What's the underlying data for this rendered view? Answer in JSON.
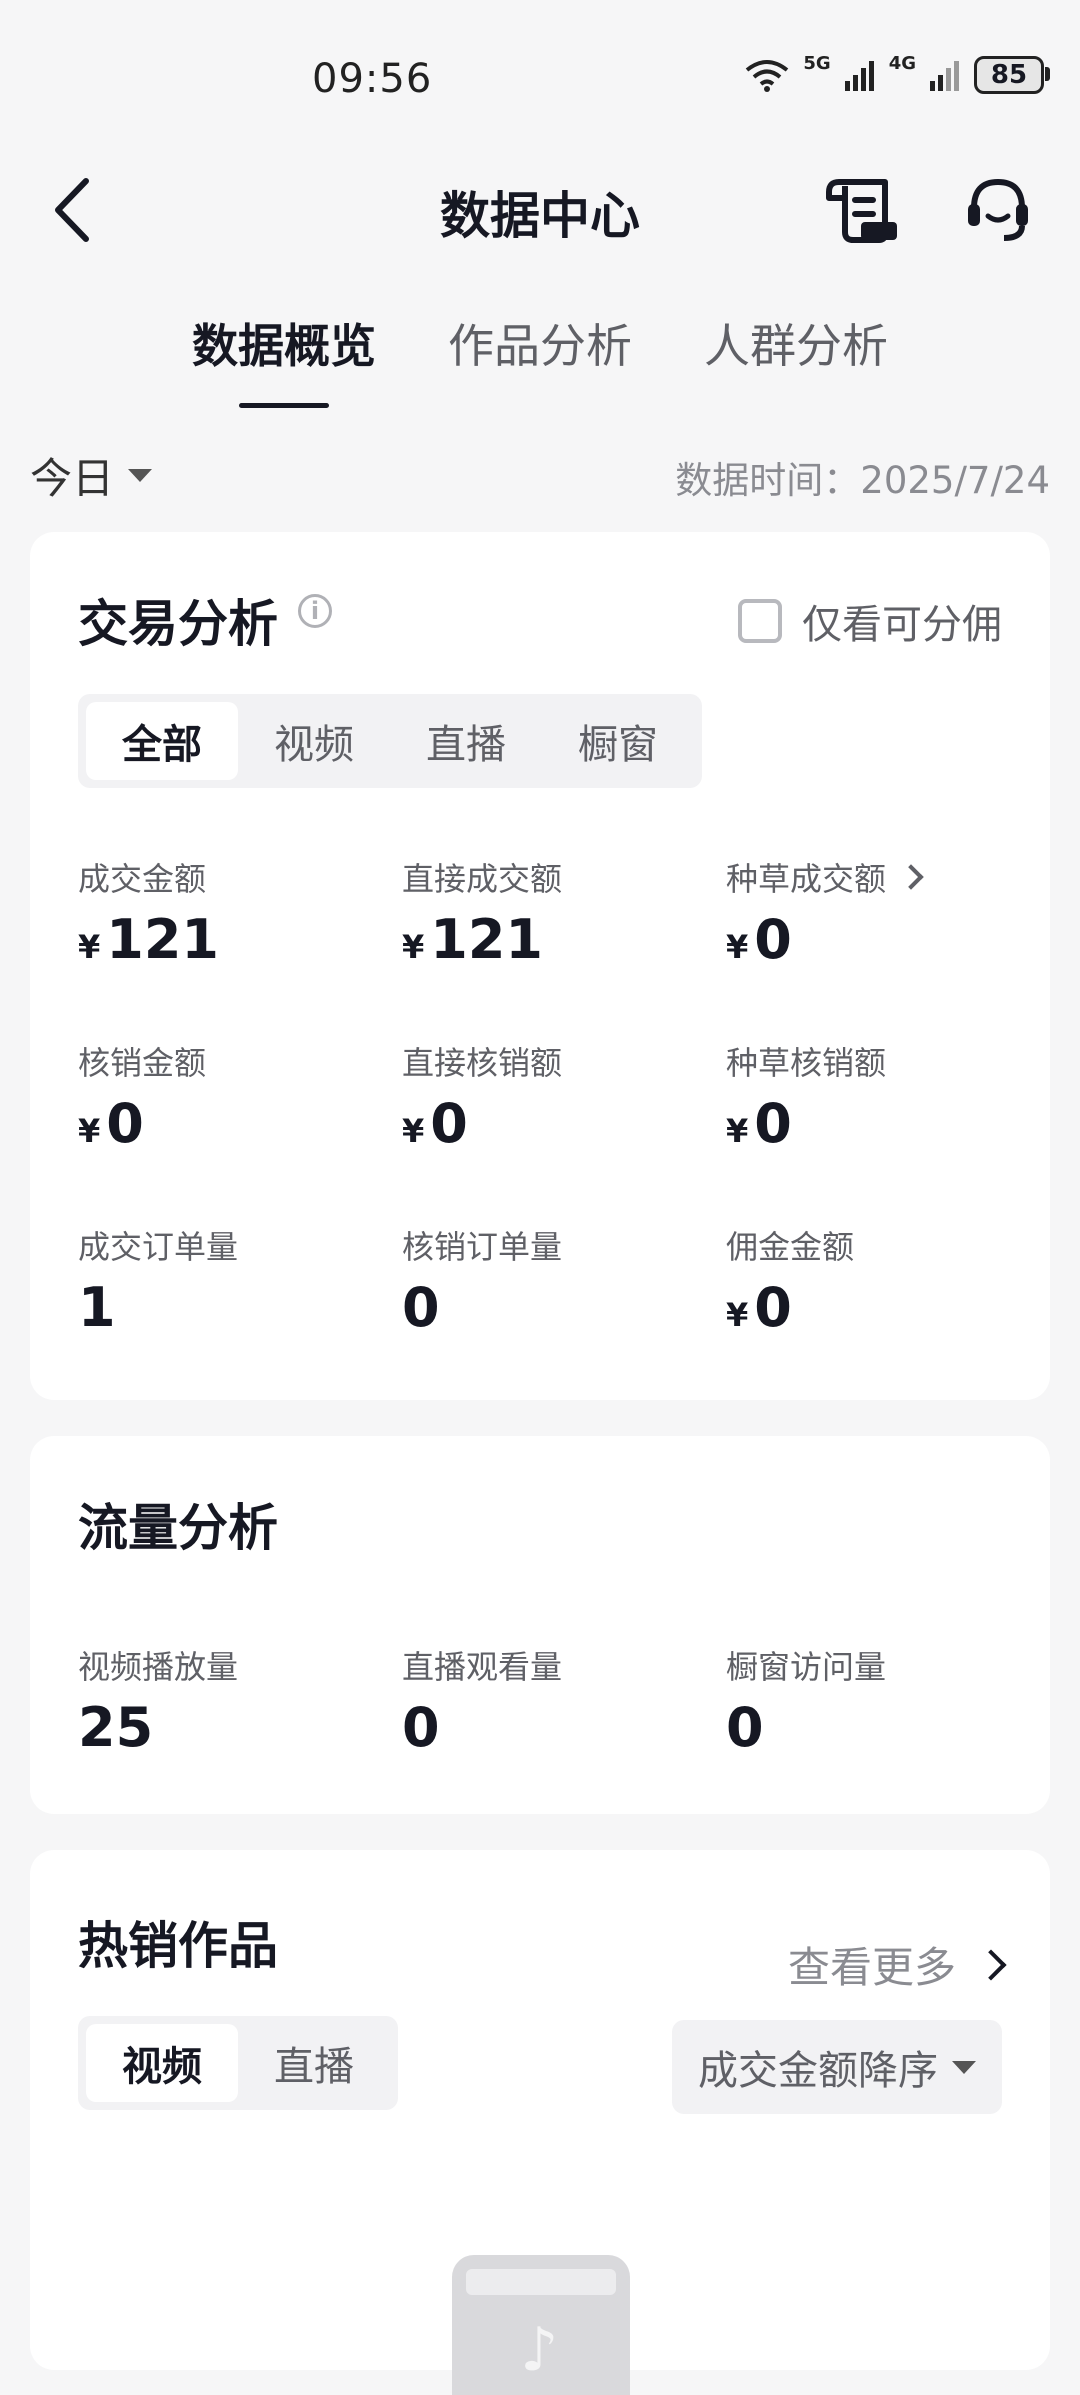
{
  "status_bar": {
    "time": "09:56",
    "battery": "85",
    "signal_1": "5G",
    "signal_2": "4G"
  },
  "header": {
    "title": "数据中心"
  },
  "tabs": [
    {
      "label": "数据概览",
      "active": true
    },
    {
      "label": "作品分析",
      "active": false
    },
    {
      "label": "人群分析",
      "active": false
    }
  ],
  "filter": {
    "period": "今日",
    "data_time": "数据时间：2025/7/24"
  },
  "trade": {
    "title": "交易分析",
    "checkbox_label": "仅看可分佣",
    "segments": [
      "全部",
      "视频",
      "直播",
      "橱窗"
    ],
    "active_segment": "全部",
    "currency": "¥",
    "metrics": [
      {
        "label": "成交金额",
        "value": "121"
      },
      {
        "label": "直接成交额",
        "value": "121"
      },
      {
        "label": "种草成交额",
        "value": "0"
      },
      {
        "label": "核销金额",
        "value": "0"
      },
      {
        "label": "直接核销额",
        "value": "0"
      },
      {
        "label": "种草核销额",
        "value": "0"
      },
      {
        "label": "成交订单量",
        "value": "1"
      },
      {
        "label": "核销订单量",
        "value": "0"
      },
      {
        "label": "佣金金额",
        "value": "0"
      }
    ]
  },
  "traffic": {
    "title": "流量分析",
    "metrics": [
      {
        "label": "视频播放量",
        "value": "25"
      },
      {
        "label": "直播观看量",
        "value": "0"
      },
      {
        "label": "橱窗访问量",
        "value": "0"
      }
    ]
  },
  "hot": {
    "title": "热销作品",
    "more": "查看更多",
    "segments": [
      "视频",
      "直播"
    ],
    "active_segment": "视频",
    "sort": "成交金额降序"
  }
}
